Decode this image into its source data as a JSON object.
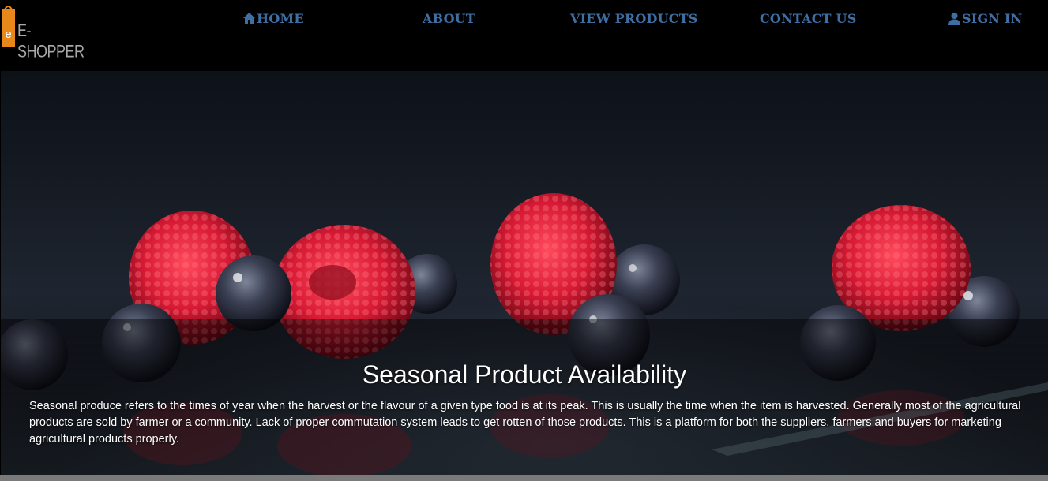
{
  "brand": {
    "logo_letter": "e",
    "name": "E-SHOPPER",
    "bag_color": "#e8881a"
  },
  "nav": {
    "home": "Home",
    "about": "About",
    "view_products": "View Products",
    "contact_us": "Contact Us",
    "sign_in": "Sign In",
    "link_color": "#3d6fa5"
  },
  "hero": {
    "title": "Seasonal Product Availability",
    "description": "Seasonal produce refers to the times of year when the harvest or the flavour of a given type food is at its peak. This is usually the time when the item is harvested. Generally most of the agricultural products are sold by farmer or a community. Lack of proper commutation system leads to get rotten of those products. This is a platform for both the suppliers, farmers and buyers for marketing agricultural products properly."
  }
}
